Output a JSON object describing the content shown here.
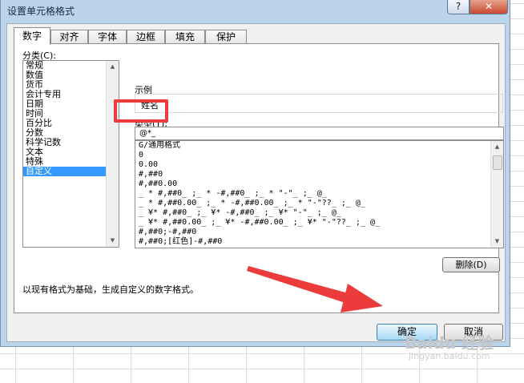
{
  "dialog": {
    "title": "设置单元格格式",
    "help_glyph": "?",
    "close_glyph": "✕"
  },
  "tabs": [
    {
      "label": "数字",
      "active": true
    },
    {
      "label": "对齐",
      "active": false
    },
    {
      "label": "字体",
      "active": false
    },
    {
      "label": "边框",
      "active": false
    },
    {
      "label": "填充",
      "active": false
    },
    {
      "label": "保护",
      "active": false
    }
  ],
  "category": {
    "label": "分类(C):",
    "items": [
      "常规",
      "数值",
      "货币",
      "会计专用",
      "日期",
      "时间",
      "百分比",
      "分数",
      "科学记数",
      "文本",
      "特殊",
      "自定义"
    ],
    "selected_index": 11
  },
  "sample": {
    "label": "示例",
    "value": "姓名"
  },
  "type": {
    "label": "类型(T):",
    "value": "@*_",
    "formats": [
      "G/通用格式",
      "0",
      "0.00",
      "#,##0",
      "#,##0.00",
      "_ * #,##0_ ;_ * -#,##0_ ;_ * \"-\"_ ;_ @_",
      "_ * #,##0.00_ ;_ * -#,##0.00_ ;_ * \"-\"??_ ;_ @_",
      "_ ¥* #,##0_ ;_ ¥* -#,##0_ ;_ ¥* \"-\"_ ;_ @_",
      "_ ¥* #,##0.00_ ;_ ¥* -#,##0.00_ ;_ ¥* \"-\"??_ ;_ @_",
      "#,##0;-#,##0",
      "#,##0;[红色]-#,##0"
    ]
  },
  "buttons": {
    "delete": "删除(D)",
    "ok": "确定",
    "cancel": "取消"
  },
  "description": "以现有格式为基础，生成自定义的数字格式。",
  "watermark": {
    "main": "Baidu 经验",
    "sub": "jingyan.baidu.com"
  },
  "colors": {
    "annotation_red": "#ec3b3b",
    "selection_blue": "#3399ff",
    "dialog_frame": "#bcd3ec"
  }
}
